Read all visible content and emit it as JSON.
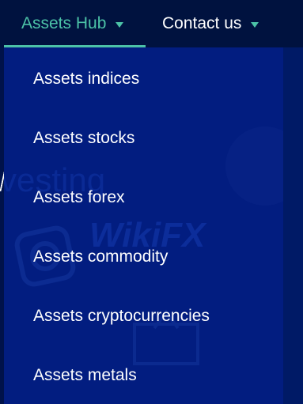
{
  "nav": {
    "assets_hub": "Assets Hub",
    "contact_us": "Contact us"
  },
  "dropdown": {
    "items": [
      {
        "label": "Assets indices"
      },
      {
        "label": "Assets stocks"
      },
      {
        "label": "Assets forex"
      },
      {
        "label": "Assets commodity"
      },
      {
        "label": "Assets cryptocurrencies"
      },
      {
        "label": "Assets metals"
      }
    ]
  },
  "watermark": {
    "text_1": "vesting",
    "text_2": "WikiFX"
  },
  "colors": {
    "nav_background": "#00123f",
    "dropdown_background": "#021d80",
    "accent": "#4cc2a7",
    "text": "#ffffff"
  }
}
